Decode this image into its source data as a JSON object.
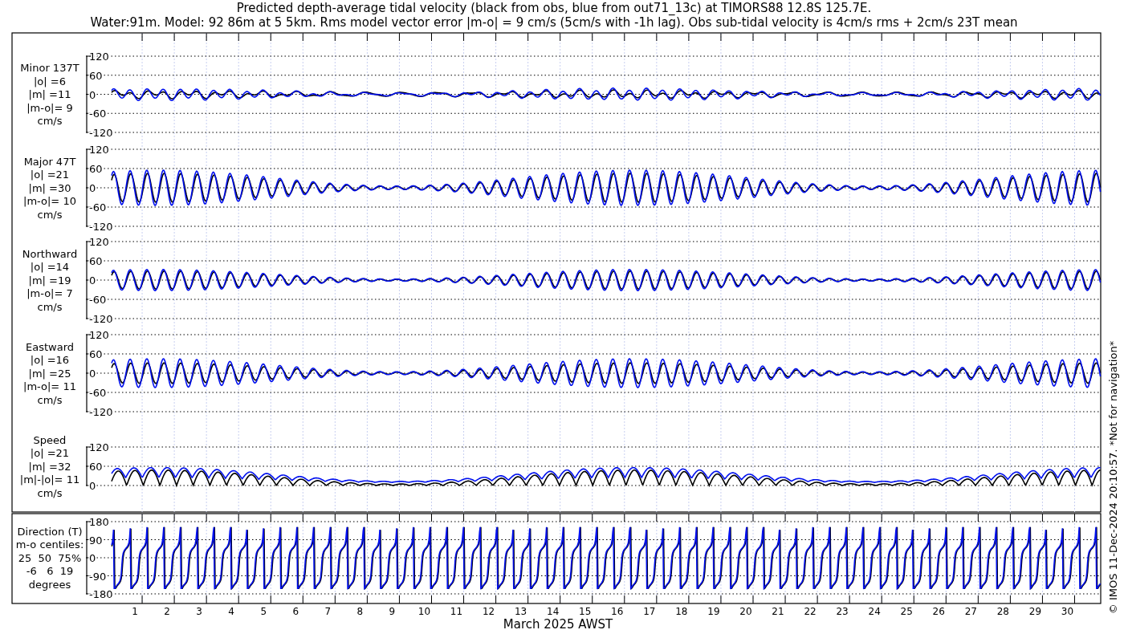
{
  "title_lines": [
    "Predicted depth-average tidal velocity (black from obs, blue from out71_13c) at TIMORS88 12.8S 125.7E.",
    "Water:91m. Model: 92 86m at 5 5km. Rms model vector error |m-o| = 9 cm/s (5cm/s with -1h lag). Obs sub-tidal velocity is 4cm/s rms + 2cm/s 23T mean"
  ],
  "panels": [
    {
      "kind": "velocity",
      "label_lines": [
        "Minor 137T",
        "|o| =6",
        "|m| =11",
        "|m-o|= 9",
        "cm/s"
      ],
      "yticks": [
        "120",
        "60",
        "0",
        "-60",
        "-120"
      ]
    },
    {
      "kind": "velocity",
      "label_lines": [
        "Major 47T",
        "|o| =21",
        "|m| =30",
        "|m-o|= 10",
        "cm/s"
      ],
      "yticks": [
        "120",
        "60",
        "0",
        "-60",
        "-120"
      ]
    },
    {
      "kind": "velocity",
      "label_lines": [
        "Northward",
        "|o| =14",
        "|m| =19",
        "|m-o|= 7",
        "cm/s"
      ],
      "yticks": [
        "120",
        "60",
        "0",
        "-60",
        "-120"
      ]
    },
    {
      "kind": "velocity",
      "label_lines": [
        "Eastward",
        "|o| =16",
        "|m| =25",
        "|m-o|= 11",
        "cm/s"
      ],
      "yticks": [
        "120",
        "60",
        "0",
        "-60",
        "-120"
      ]
    },
    {
      "kind": "speed",
      "label_lines": [
        "Speed",
        "|o| =21",
        "|m| =32",
        "|m|-|o|= 11",
        "cm/s"
      ],
      "yticks": [
        "120",
        "60",
        "0"
      ]
    },
    {
      "kind": "direction",
      "label_lines": [
        "Direction (T)",
        "m-o centiles:",
        "25  50  75%",
        "-6   6  19",
        "degrees"
      ],
      "yticks": [
        "180",
        "90",
        "0",
        "-90",
        "-180"
      ]
    }
  ],
  "x_axis": {
    "day_labels": [
      "1",
      "2",
      "3",
      "4",
      "5",
      "6",
      "7",
      "8",
      "9",
      "10",
      "11",
      "12",
      "13",
      "14",
      "15",
      "16",
      "17",
      "18",
      "19",
      "20",
      "21",
      "22",
      "23",
      "24",
      "25",
      "26",
      "27",
      "28",
      "29",
      "30"
    ],
    "label": "March 2025 AWST"
  },
  "credit": "© IMOS 11-Dec-2024 20:10:57. *Not for navigation*"
}
